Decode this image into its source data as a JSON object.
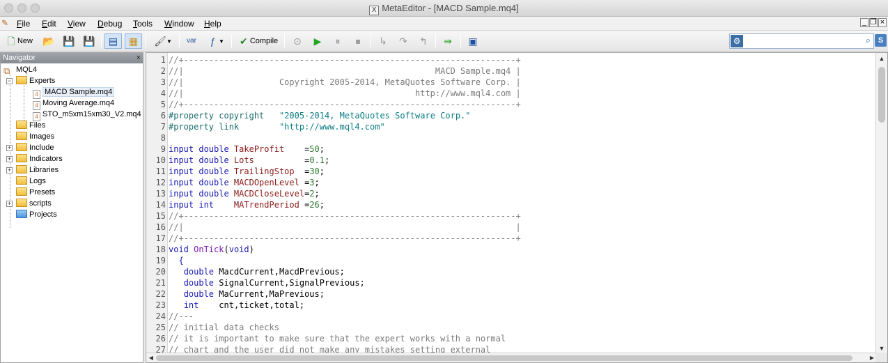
{
  "window": {
    "title": "MetaEditor - [MACD Sample.mq4]",
    "logo_glyph": "X"
  },
  "menu": {
    "items": [
      {
        "label": "File",
        "accel": "F"
      },
      {
        "label": "Edit",
        "accel": "E"
      },
      {
        "label": "View",
        "accel": "V"
      },
      {
        "label": "Debug",
        "accel": "D"
      },
      {
        "label": "Tools",
        "accel": "T"
      },
      {
        "label": "Window",
        "accel": "W"
      },
      {
        "label": "Help",
        "accel": "H"
      }
    ]
  },
  "toolbar": {
    "new_label": "New",
    "compile_label": "Compile",
    "var_label": "var",
    "search": {
      "value": "",
      "placeholder": ""
    },
    "badge": "S",
    "icons": [
      "new-icon",
      "open-folder-icon",
      "save-icon",
      "save-all-icon",
      "navigator-toggle-icon",
      "toolbox-toggle-icon",
      "styler-icon",
      "insert-variable-icon",
      "insert-function-icon",
      "compile-icon",
      "step-back-icon",
      "start-debug-icon",
      "pause-icon",
      "stop-icon",
      "step-into-icon",
      "step-over-icon",
      "step-out-icon",
      "go-to-icon",
      "terminal-icon",
      "gear-icon",
      "search-icon"
    ]
  },
  "navigator": {
    "title": "Navigator",
    "close": "×",
    "root": "MQL4",
    "items": [
      {
        "label": "Experts",
        "expander": "−",
        "type": "folder"
      },
      {
        "label": "MACD Sample.mq4",
        "type": "file",
        "selected": true
      },
      {
        "label": "Moving Average.mq4",
        "type": "file"
      },
      {
        "label": "STO_m5xm15xm30_V2.mq4",
        "type": "file"
      },
      {
        "label": "Files",
        "type": "folder"
      },
      {
        "label": "Images",
        "type": "folder"
      },
      {
        "label": "Include",
        "expander": "+",
        "type": "folder"
      },
      {
        "label": "Indicators",
        "expander": "+",
        "type": "folder"
      },
      {
        "label": "Libraries",
        "expander": "+",
        "type": "folder"
      },
      {
        "label": "Logs",
        "type": "folder"
      },
      {
        "label": "Presets",
        "type": "folder"
      },
      {
        "label": "scripts",
        "expander": "+",
        "type": "folder"
      },
      {
        "label": "Projects",
        "type": "folder-blue"
      }
    ]
  },
  "editor": {
    "lines": [
      [
        {
          "t": "//+------------------------------------------------------------------+",
          "c": "cm"
        }
      ],
      [
        {
          "t": "//|                                                  MACD Sample.mq4 |",
          "c": "cm"
        }
      ],
      [
        {
          "t": "//|                   Copyright 2005-2014, MetaQuotes Software Corp. |",
          "c": "cm"
        }
      ],
      [
        {
          "t": "//|                                              http://www.mql4.com |",
          "c": "cm"
        }
      ],
      [
        {
          "t": "//+------------------------------------------------------------------+",
          "c": "cm"
        }
      ],
      [
        {
          "t": "#property copyright",
          "c": "pr"
        },
        {
          "t": "   ",
          "c": ""
        },
        {
          "t": "\"2005-2014, MetaQuotes Software Corp.\"",
          "c": "st"
        }
      ],
      [
        {
          "t": "#property link",
          "c": "pr"
        },
        {
          "t": "        ",
          "c": ""
        },
        {
          "t": "\"http://www.mql4.com\"",
          "c": "st"
        }
      ],
      [],
      [
        {
          "t": "input double ",
          "c": "kw"
        },
        {
          "t": "TakeProfit",
          "c": "vr"
        },
        {
          "t": "    =",
          "c": ""
        },
        {
          "t": "50",
          "c": "nm"
        },
        {
          "t": ";",
          "c": ""
        }
      ],
      [
        {
          "t": "input double ",
          "c": "kw"
        },
        {
          "t": "Lots",
          "c": "vr"
        },
        {
          "t": "          =",
          "c": ""
        },
        {
          "t": "0.1",
          "c": "nm"
        },
        {
          "t": ";",
          "c": ""
        }
      ],
      [
        {
          "t": "input double ",
          "c": "kw"
        },
        {
          "t": "TrailingStop",
          "c": "vr"
        },
        {
          "t": "  =",
          "c": ""
        },
        {
          "t": "30",
          "c": "nm"
        },
        {
          "t": ";",
          "c": ""
        }
      ],
      [
        {
          "t": "input double ",
          "c": "kw"
        },
        {
          "t": "MACDOpenLevel",
          "c": "vr"
        },
        {
          "t": " =",
          "c": ""
        },
        {
          "t": "3",
          "c": "nm"
        },
        {
          "t": ";",
          "c": ""
        }
      ],
      [
        {
          "t": "input double ",
          "c": "kw"
        },
        {
          "t": "MACDCloseLevel",
          "c": "vr"
        },
        {
          "t": "=",
          "c": ""
        },
        {
          "t": "2",
          "c": "nm"
        },
        {
          "t": ";",
          "c": ""
        }
      ],
      [
        {
          "t": "input int    ",
          "c": "kw"
        },
        {
          "t": "MATrendPeriod",
          "c": "vr"
        },
        {
          "t": " =",
          "c": ""
        },
        {
          "t": "26",
          "c": "nm"
        },
        {
          "t": ";",
          "c": ""
        }
      ],
      [
        {
          "t": "//+------------------------------------------------------------------+",
          "c": "cm"
        }
      ],
      [
        {
          "t": "//|                                                                  |",
          "c": "cm"
        }
      ],
      [
        {
          "t": "//+------------------------------------------------------------------+",
          "c": "cm"
        }
      ],
      [
        {
          "t": "void ",
          "c": "kw"
        },
        {
          "t": "OnTick",
          "c": "fn"
        },
        {
          "t": "(",
          "c": ""
        },
        {
          "t": "void",
          "c": "kw"
        },
        {
          "t": ")",
          "c": ""
        }
      ],
      [
        {
          "t": "  {",
          "c": "kw"
        }
      ],
      [
        {
          "t": "   ",
          "c": ""
        },
        {
          "t": "double ",
          "c": "kw"
        },
        {
          "t": "MacdCurrent,MacdPrevious;",
          "c": ""
        }
      ],
      [
        {
          "t": "   ",
          "c": ""
        },
        {
          "t": "double ",
          "c": "kw"
        },
        {
          "t": "SignalCurrent,SignalPrevious;",
          "c": ""
        }
      ],
      [
        {
          "t": "   ",
          "c": ""
        },
        {
          "t": "double ",
          "c": "kw"
        },
        {
          "t": "MaCurrent,MaPrevious;",
          "c": ""
        }
      ],
      [
        {
          "t": "   ",
          "c": ""
        },
        {
          "t": "int    ",
          "c": "kw"
        },
        {
          "t": "cnt,ticket,total;",
          "c": ""
        }
      ],
      [
        {
          "t": "//---",
          "c": "cm"
        }
      ],
      [
        {
          "t": "// initial data checks",
          "c": "cm"
        }
      ],
      [
        {
          "t": "// it is important to make sure that the expert works with a normal",
          "c": "cm"
        }
      ],
      [
        {
          "t": "// chart and the user did not make any mistakes setting external",
          "c": "cm"
        }
      ]
    ]
  }
}
